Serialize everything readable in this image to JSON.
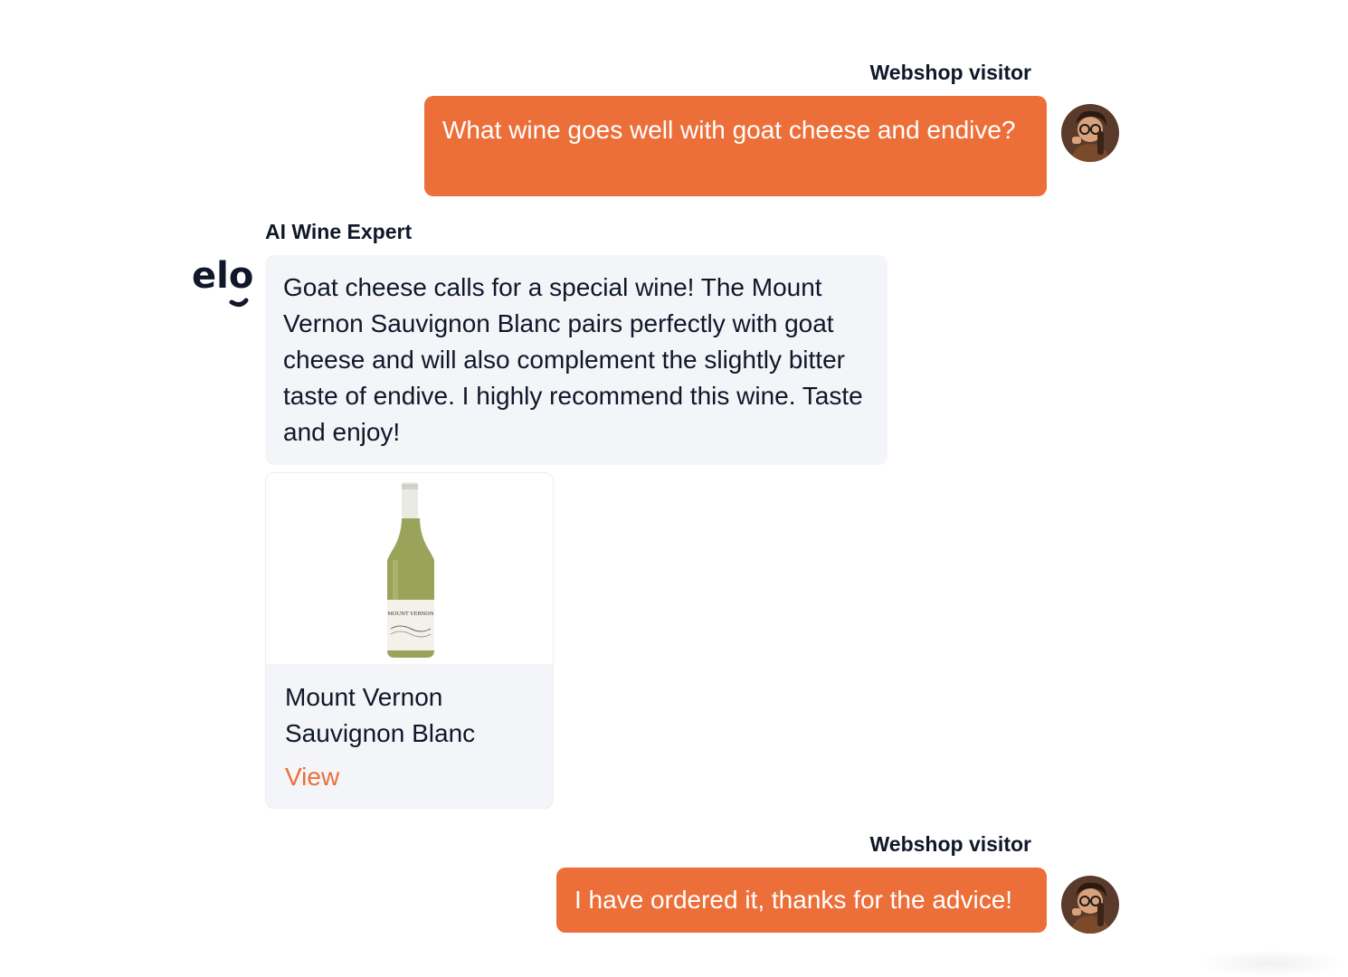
{
  "colors": {
    "accent": "#ec6f39",
    "bot_bubble": "#f3f5f8",
    "text": "#0f1729"
  },
  "messages": [
    {
      "sender": "Webshop visitor",
      "text": "What wine goes well with goat cheese and endive?",
      "avatar_icon": "user-avatar-icon"
    },
    {
      "sender": "AI Wine Expert",
      "text": "Goat cheese calls for a special wine! The Mount Vernon Sauvignon Blanc pairs perfectly with goat cheese and will also complement the slightly bitter taste of endive. I highly recommend this wine. Taste and enjoy!",
      "avatar_icon": "elo-logo-icon",
      "logo_text": "elo"
    },
    {
      "sender": "Webshop visitor",
      "text": "I have ordered it, thanks for the advice!",
      "avatar_icon": "user-avatar-icon"
    }
  ],
  "product": {
    "name": "Mount Vernon Sauvignon Blanc",
    "link_label": "View",
    "image_icon": "wine-bottle-icon",
    "label_text": "MOUNT VERNON"
  }
}
